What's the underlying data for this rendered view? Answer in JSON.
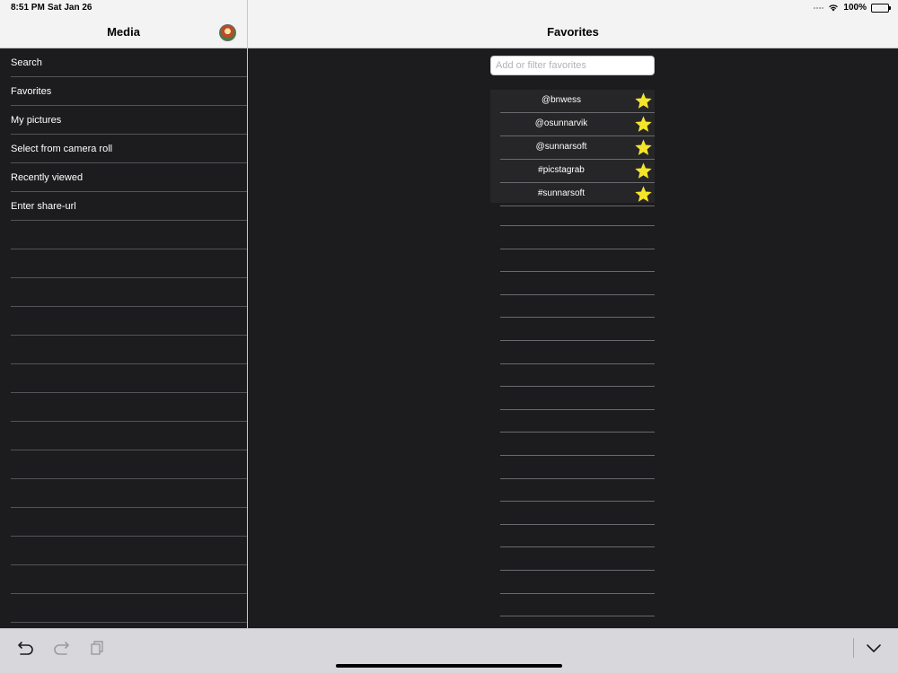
{
  "status": {
    "time": "8:51 PM",
    "date": "Sat Jan 26",
    "battery": "100%",
    "battery_level": 1.0
  },
  "sidebar": {
    "title": "Media",
    "items": [
      {
        "label": "Search"
      },
      {
        "label": "Favorites"
      },
      {
        "label": "My pictures"
      },
      {
        "label": "Select from camera roll"
      },
      {
        "label": "Recently viewed"
      },
      {
        "label": "Enter share-url"
      }
    ]
  },
  "main": {
    "title": "Favorites",
    "search_placeholder": "Add or filter favorites",
    "favorites": [
      {
        "label": "@bnwess",
        "icon": "star-icon"
      },
      {
        "label": "@osunnarvik",
        "icon": "star-icon"
      },
      {
        "label": "@sunnarsoft",
        "icon": "star-icon"
      },
      {
        "label": "#picstagrab",
        "icon": "star-icon"
      },
      {
        "label": "#sunnarsoft",
        "icon": "star-icon"
      }
    ]
  },
  "toolbar": {
    "icons": [
      "undo-icon",
      "redo-icon",
      "paste-icon",
      "chevron-down-icon"
    ]
  },
  "colors": {
    "star": "#f5e52a",
    "background": "#1c1c1e",
    "bar": "#f3f3f4"
  }
}
